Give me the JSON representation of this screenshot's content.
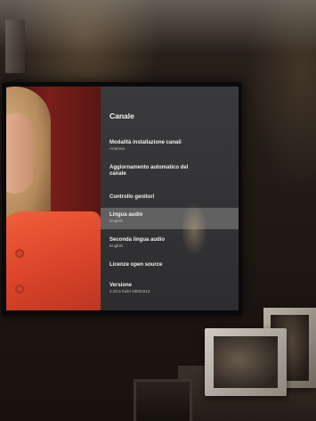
{
  "settings_panel": {
    "title": "Canale",
    "items": [
      {
        "label": "Modalità installazione canali",
        "sub": "Antenna"
      },
      {
        "label": "Aggiornamento automatico del canale",
        "sub": ""
      },
      {
        "label": "Controllo genitori",
        "sub": ""
      },
      {
        "label": "Lingua audio",
        "sub": "English"
      },
      {
        "label": "Seconda lingua audio",
        "sub": "English"
      },
      {
        "label": "Licenze open source",
        "sub": ""
      },
      {
        "label": "Versione",
        "sub": "2.26.5 build 18551513"
      }
    ],
    "selected_index": 3,
    "auto_update_toggle": "on"
  }
}
